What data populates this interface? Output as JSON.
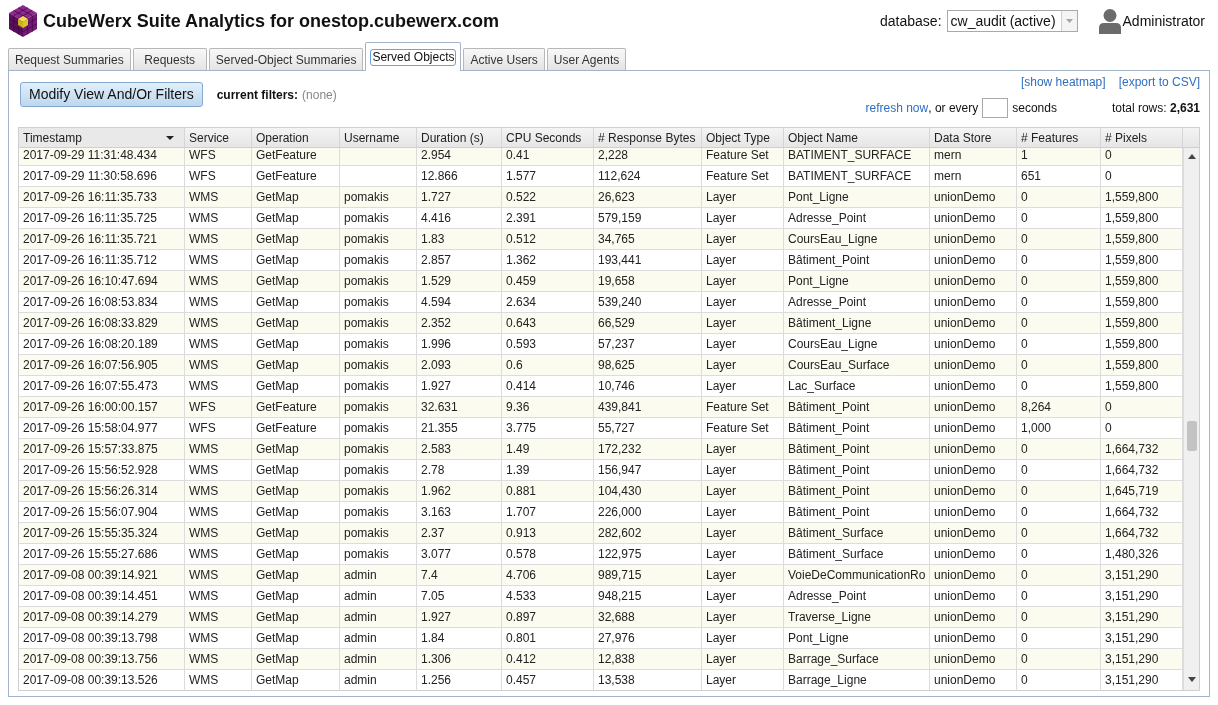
{
  "header": {
    "title": "CubeWerx Suite Analytics for onestop.cubewerx.com",
    "database_label": "database:",
    "database_value": "cw_audit (active)",
    "user": "Administrator"
  },
  "tabs": [
    {
      "label": "Request Summaries",
      "selected": false
    },
    {
      "label": "Requests",
      "selected": false
    },
    {
      "label": "Served-Object Summaries",
      "selected": false
    },
    {
      "label": "Served Objects",
      "selected": true
    },
    {
      "label": "Active Users",
      "selected": false
    },
    {
      "label": "User Agents",
      "selected": false
    }
  ],
  "toolbar": {
    "button": "Modify View And/Or Filters",
    "filters_label": "current filters:",
    "filters_value": "(none)",
    "links": [
      "[show heatmap]",
      "[export to CSV]"
    ],
    "refresh_link": "refresh now",
    "refresh_text": ", or every",
    "refresh_unit": "seconds",
    "total_rows": "total rows: **2,631**"
  },
  "table": {
    "columns": [
      {
        "label": "Timestamp",
        "sorted": true
      },
      {
        "label": "Service",
        "sorted": false
      },
      {
        "label": "Operation",
        "sorted": false
      },
      {
        "label": "Username",
        "sorted": false
      },
      {
        "label": "Duration (s)",
        "sorted": false
      },
      {
        "label": "CPU Seconds",
        "sorted": false
      },
      {
        "label": "# Response Bytes",
        "sorted": false
      },
      {
        "label": "Object Type",
        "sorted": false
      },
      {
        "label": "Object Name",
        "sorted": false
      },
      {
        "label": "Data Store",
        "sorted": false
      },
      {
        "label": "# Features",
        "sorted": false
      },
      {
        "label": "# Pixels",
        "sorted": false
      }
    ],
    "rows": [
      [
        "2017-09-29 11:31:48.434",
        "WFS",
        "GetFeature",
        null,
        "2.954",
        "0.41",
        "2,228",
        "Feature Set",
        "BATIMENT_SURFACE",
        "mern",
        "1",
        "0"
      ],
      [
        "2017-09-29 11:30:58.696",
        "WFS",
        "GetFeature",
        null,
        "12.866",
        "1.577",
        "112,624",
        "Feature Set",
        "BATIMENT_SURFACE",
        "mern",
        "651",
        "0"
      ],
      [
        "2017-09-26 16:11:35.733",
        "WMS",
        "GetMap",
        "pomakis",
        "1.727",
        "0.522",
        "26,623",
        "Layer",
        "Pont_Ligne",
        "unionDemo",
        "0",
        "1,559,800"
      ],
      [
        "2017-09-26 16:11:35.725",
        "WMS",
        "GetMap",
        "pomakis",
        "4.416",
        "2.391",
        "579,159",
        "Layer",
        "Adresse_Point",
        "unionDemo",
        "0",
        "1,559,800"
      ],
      [
        "2017-09-26 16:11:35.721",
        "WMS",
        "GetMap",
        "pomakis",
        "1.83",
        "0.512",
        "34,765",
        "Layer",
        "CoursEau_Ligne",
        "unionDemo",
        "0",
        "1,559,800"
      ],
      [
        "2017-09-26 16:11:35.712",
        "WMS",
        "GetMap",
        "pomakis",
        "2.857",
        "1.362",
        "193,441",
        "Layer",
        "Bâtiment_Point",
        "unionDemo",
        "0",
        "1,559,800"
      ],
      [
        "2017-09-26 16:10:47.694",
        "WMS",
        "GetMap",
        "pomakis",
        "1.529",
        "0.459",
        "19,658",
        "Layer",
        "Pont_Ligne",
        "unionDemo",
        "0",
        "1,559,800"
      ],
      [
        "2017-09-26 16:08:53.834",
        "WMS",
        "GetMap",
        "pomakis",
        "4.594",
        "2.634",
        "539,240",
        "Layer",
        "Adresse_Point",
        "unionDemo",
        "0",
        "1,559,800"
      ],
      [
        "2017-09-26 16:08:33.829",
        "WMS",
        "GetMap",
        "pomakis",
        "2.352",
        "0.643",
        "66,529",
        "Layer",
        "Bâtiment_Ligne",
        "unionDemo",
        "0",
        "1,559,800"
      ],
      [
        "2017-09-26 16:08:20.189",
        "WMS",
        "GetMap",
        "pomakis",
        "1.996",
        "0.593",
        "57,237",
        "Layer",
        "CoursEau_Ligne",
        "unionDemo",
        "0",
        "1,559,800"
      ],
      [
        "2017-09-26 16:07:56.905",
        "WMS",
        "GetMap",
        "pomakis",
        "2.093",
        "0.6",
        "98,625",
        "Layer",
        "CoursEau_Surface",
        "unionDemo",
        "0",
        "1,559,800"
      ],
      [
        "2017-09-26 16:07:55.473",
        "WMS",
        "GetMap",
        "pomakis",
        "1.927",
        "0.414",
        "10,746",
        "Layer",
        "Lac_Surface",
        "unionDemo",
        "0",
        "1,559,800"
      ],
      [
        "2017-09-26 16:00:00.157",
        "WFS",
        "GetFeature",
        "pomakis",
        "32.631",
        "9.36",
        "439,841",
        "Feature Set",
        "Bâtiment_Point",
        "unionDemo",
        "8,264",
        "0"
      ],
      [
        "2017-09-26 15:58:04.977",
        "WFS",
        "GetFeature",
        "pomakis",
        "21.355",
        "3.775",
        "55,727",
        "Feature Set",
        "Bâtiment_Point",
        "unionDemo",
        "1,000",
        "0"
      ],
      [
        "2017-09-26 15:57:33.875",
        "WMS",
        "GetMap",
        "pomakis",
        "2.583",
        "1.49",
        "172,232",
        "Layer",
        "Bâtiment_Point",
        "unionDemo",
        "0",
        "1,664,732"
      ],
      [
        "2017-09-26 15:56:52.928",
        "WMS",
        "GetMap",
        "pomakis",
        "2.78",
        "1.39",
        "156,947",
        "Layer",
        "Bâtiment_Point",
        "unionDemo",
        "0",
        "1,664,732"
      ],
      [
        "2017-09-26 15:56:26.314",
        "WMS",
        "GetMap",
        "pomakis",
        "1.962",
        "0.881",
        "104,430",
        "Layer",
        "Bâtiment_Point",
        "unionDemo",
        "0",
        "1,645,719"
      ],
      [
        "2017-09-26 15:56:07.904",
        "WMS",
        "GetMap",
        "pomakis",
        "3.163",
        "1.707",
        "226,000",
        "Layer",
        "Bâtiment_Point",
        "unionDemo",
        "0",
        "1,664,732"
      ],
      [
        "2017-09-26 15:55:35.324",
        "WMS",
        "GetMap",
        "pomakis",
        "2.37",
        "0.913",
        "282,602",
        "Layer",
        "Bâtiment_Surface",
        "unionDemo",
        "0",
        "1,664,732"
      ],
      [
        "2017-09-26 15:55:27.686",
        "WMS",
        "GetMap",
        "pomakis",
        "3.077",
        "0.578",
        "122,975",
        "Layer",
        "Bâtiment_Surface",
        "unionDemo",
        "0",
        "1,480,326"
      ],
      [
        "2017-09-08 00:39:14.921",
        "WMS",
        "GetMap",
        "admin",
        "7.4",
        "4.706",
        "989,715",
        "Layer",
        "VoieDeCommunicationRo",
        "unionDemo",
        "0",
        "3,151,290"
      ],
      [
        "2017-09-08 00:39:14.451",
        "WMS",
        "GetMap",
        "admin",
        "7.05",
        "4.533",
        "948,215",
        "Layer",
        "Adresse_Point",
        "unionDemo",
        "0",
        "3,151,290"
      ],
      [
        "2017-09-08 00:39:14.279",
        "WMS",
        "GetMap",
        "admin",
        "1.927",
        "0.897",
        "32,688",
        "Layer",
        "Traverse_Ligne",
        "unionDemo",
        "0",
        "3,151,290"
      ],
      [
        "2017-09-08 00:39:13.798",
        "WMS",
        "GetMap",
        "admin",
        "1.84",
        "0.801",
        "27,976",
        "Layer",
        "Pont_Ligne",
        "unionDemo",
        "0",
        "3,151,290"
      ],
      [
        "2017-09-08 00:39:13.756",
        "WMS",
        "GetMap",
        "admin",
        "1.306",
        "0.412",
        "12,838",
        "Layer",
        "Barrage_Surface",
        "unionDemo",
        "0",
        "3,151,290"
      ],
      [
        "2017-09-08 00:39:13.526",
        "WMS",
        "GetMap",
        "admin",
        "1.256",
        "0.457",
        "13,538",
        "Layer",
        "Barrage_Ligne",
        "unionDemo",
        "0",
        "3,151,290"
      ]
    ]
  }
}
